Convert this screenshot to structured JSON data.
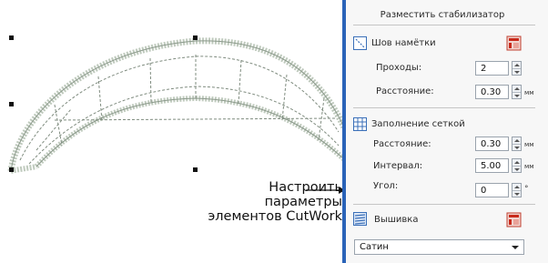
{
  "callout": {
    "line1": "Настроить",
    "line2": "параметры",
    "line3": "элементов CutWork"
  },
  "panel": {
    "title": "Разместить стабилизатор",
    "running": {
      "label": "Шов намётки",
      "passes_label": "Проходы:",
      "passes_value": "2",
      "spacing_label": "Расстояние:",
      "spacing_value": "0.30",
      "spacing_unit": "мм"
    },
    "grid": {
      "label": "Заполнение сеткой",
      "spacing_label": "Расстояние:",
      "spacing_value": "0.30",
      "spacing_unit": "мм",
      "interval_label": "Интервал:",
      "interval_value": "5.00",
      "interval_unit": "мм",
      "angle_label": "Угол:",
      "angle_value": "0",
      "angle_unit": "°"
    },
    "edge": {
      "label": "Вышивка",
      "select_value": "Сатин"
    }
  },
  "colors": {
    "divider": "#2a63b8",
    "stitch": "#b6c2b6"
  }
}
